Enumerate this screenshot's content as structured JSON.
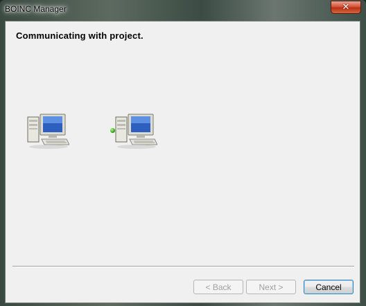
{
  "window": {
    "title": "BOINC Manager",
    "close_glyph": "✕"
  },
  "page": {
    "heading": "Communicating with project."
  },
  "icons": {
    "left_computer": "computer-icon",
    "right_computer": "computer-icon",
    "status": "green-dot-icon"
  },
  "buttons": {
    "back_label": "< Back",
    "next_label": "Next >",
    "cancel_label": "Cancel",
    "back_enabled": false,
    "next_enabled": false
  },
  "colors": {
    "status_dot": "#2fa31a",
    "close_button": "#c7462b"
  }
}
